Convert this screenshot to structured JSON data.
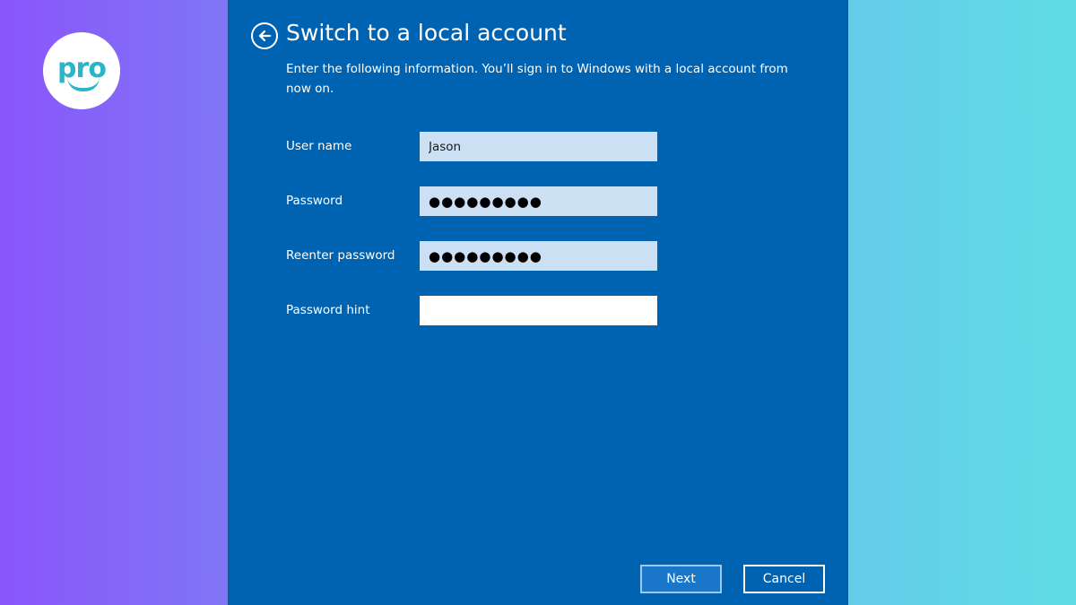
{
  "logo": {
    "text": "pro",
    "color": "#2bb5c9"
  },
  "dialog": {
    "background_color": "#0063b1",
    "back_icon": "arrow-left-circle-icon",
    "title": "Switch to a local account",
    "description": "Enter the following information. You’ll sign in to Windows with a local account from now on.",
    "fields": {
      "username": {
        "label": "User name",
        "value": "Jason"
      },
      "password": {
        "label": "Password",
        "value": "●●●●●●●●●"
      },
      "reenter_password": {
        "label": "Reenter password",
        "value": "●●●●●●●●●"
      },
      "password_hint": {
        "label": "Password hint",
        "value": ""
      }
    },
    "buttons": {
      "next": "Next",
      "cancel": "Cancel"
    }
  }
}
